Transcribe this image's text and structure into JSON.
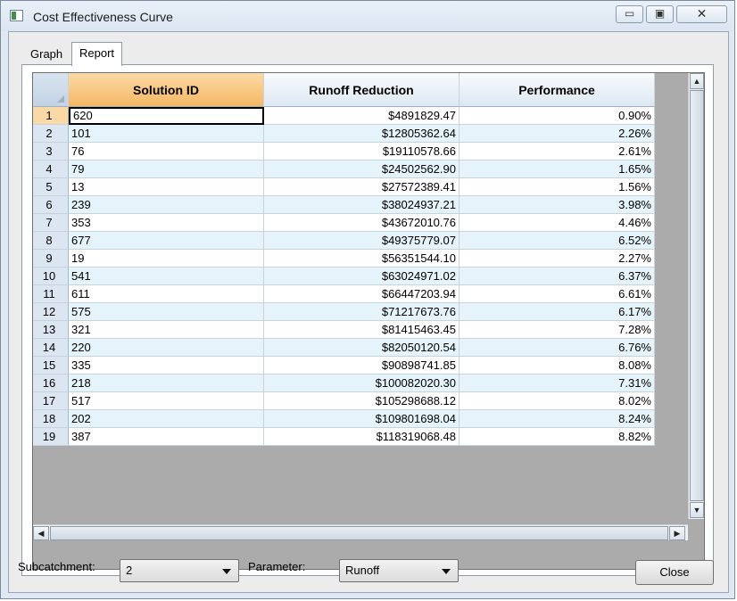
{
  "window": {
    "title": "Cost Effectiveness Curve",
    "minimize_glyph": "▭",
    "maximize_glyph": "▣",
    "close_glyph": "✕"
  },
  "tabs": [
    {
      "label": "Graph",
      "active": false
    },
    {
      "label": "Report",
      "active": true
    }
  ],
  "table": {
    "columns": [
      "Solution ID",
      "Runoff Reduction",
      "Performance"
    ],
    "rows": [
      {
        "num": "1",
        "id": "620",
        "runoff": "$4891829.47",
        "perf": "0.90%"
      },
      {
        "num": "2",
        "id": "101",
        "runoff": "$12805362.64",
        "perf": "2.26%"
      },
      {
        "num": "3",
        "id": "76",
        "runoff": "$19110578.66",
        "perf": "2.61%"
      },
      {
        "num": "4",
        "id": "79",
        "runoff": "$24502562.90",
        "perf": "1.65%"
      },
      {
        "num": "5",
        "id": "13",
        "runoff": "$27572389.41",
        "perf": "1.56%"
      },
      {
        "num": "6",
        "id": "239",
        "runoff": "$38024937.21",
        "perf": "3.98%"
      },
      {
        "num": "7",
        "id": "353",
        "runoff": "$43672010.76",
        "perf": "4.46%"
      },
      {
        "num": "8",
        "id": "677",
        "runoff": "$49375779.07",
        "perf": "6.52%"
      },
      {
        "num": "9",
        "id": "19",
        "runoff": "$56351544.10",
        "perf": "2.27%"
      },
      {
        "num": "10",
        "id": "541",
        "runoff": "$63024971.02",
        "perf": "6.37%"
      },
      {
        "num": "11",
        "id": "611",
        "runoff": "$66447203.94",
        "perf": "6.61%"
      },
      {
        "num": "12",
        "id": "575",
        "runoff": "$71217673.76",
        "perf": "6.17%"
      },
      {
        "num": "13",
        "id": "321",
        "runoff": "$81415463.45",
        "perf": "7.28%"
      },
      {
        "num": "14",
        "id": "220",
        "runoff": "$82050120.54",
        "perf": "6.76%"
      },
      {
        "num": "15",
        "id": "335",
        "runoff": "$90898741.85",
        "perf": "8.08%"
      },
      {
        "num": "16",
        "id": "218",
        "runoff": "$100082020.30",
        "perf": "7.31%"
      },
      {
        "num": "17",
        "id": "517",
        "runoff": "$105298688.12",
        "perf": "8.02%"
      },
      {
        "num": "18",
        "id": "202",
        "runoff": "$109801698.04",
        "perf": "8.24%"
      },
      {
        "num": "19",
        "id": "387",
        "runoff": "$118319068.48",
        "perf": "8.82%"
      }
    ]
  },
  "scroll": {
    "up": "▲",
    "down": "▼",
    "left": "◀",
    "right": "▶"
  },
  "controls": {
    "subcatchment_label": "Subcatchment:",
    "subcatchment_value": "2",
    "parameter_label": "Parameter:",
    "parameter_value": "Runoff",
    "close_label": "Close"
  },
  "colors": {
    "selected_header": "#f5b864",
    "alt_row": "#e5f3fb",
    "grid_background": "#ababab"
  }
}
